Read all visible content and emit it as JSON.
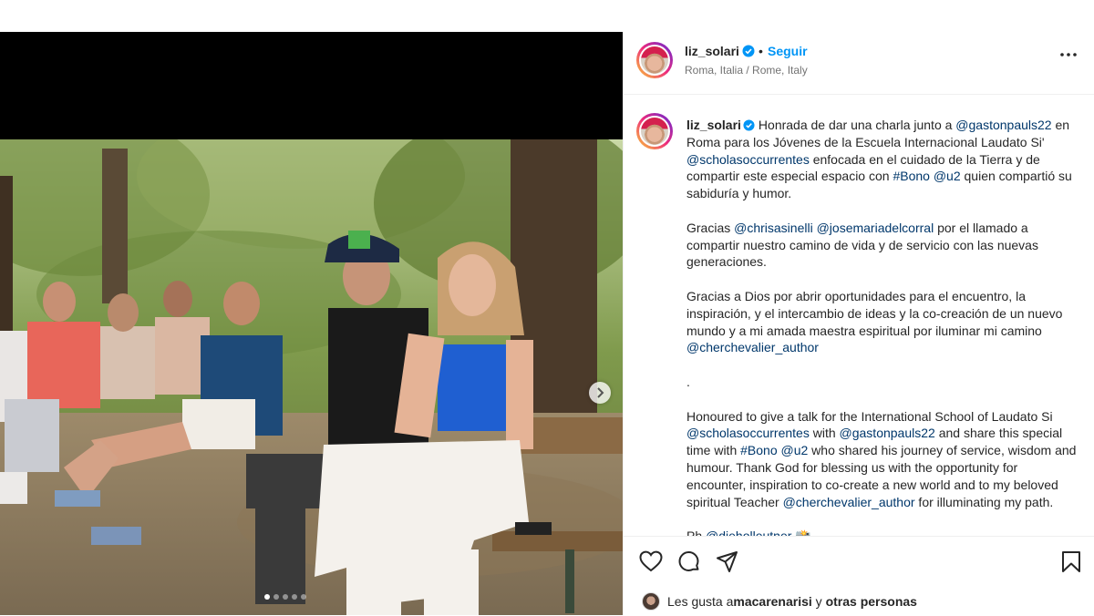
{
  "post": {
    "author": "liz_solari",
    "follow_label": "Seguir",
    "separator": "•",
    "location": "Roma, Italia / Rome, Italy"
  },
  "caption": {
    "p1": [
      {
        "t": "Honrada de dar una charla junto a ",
        "link": false
      },
      {
        "t": "@gastonpauls22",
        "link": true
      },
      {
        "t": " en Roma para los Jóvenes de la Escuela Internacional Laudato Si' ",
        "link": false
      },
      {
        "t": "@scholasoccurrentes",
        "link": true
      },
      {
        "t": " enfocada en el cuidado de la Tierra y de compartir este especial espacio con ",
        "link": false
      },
      {
        "t": "#Bono",
        "link": true
      },
      {
        "t": " ",
        "link": false
      },
      {
        "t": "@u2",
        "link": true
      },
      {
        "t": " quien compartió su sabiduría y humor.",
        "link": false
      }
    ],
    "p2": [
      {
        "t": "Gracias ",
        "link": false
      },
      {
        "t": "@chrisasinelli",
        "link": true
      },
      {
        "t": " ",
        "link": false
      },
      {
        "t": "@josemariadelcorral",
        "link": true
      },
      {
        "t": " por el llamado a compartir nuestro camino de vida y de servicio con las nuevas generaciones.",
        "link": false
      }
    ],
    "p3": [
      {
        "t": "Gracias a Dios por abrir oportunidades para el encuentro, la inspiración, y el intercambio de ideas y la co-creación de un nuevo mundo y a mi amada maestra espiritual por iluminar mi camino ",
        "link": false
      },
      {
        "t": "@cherchevalier_author",
        "link": true
      }
    ],
    "p4": [
      {
        "t": ".",
        "link": false
      }
    ],
    "p5": [
      {
        "t": "Honoured to give a talk for the International School of Laudato Si ",
        "link": false
      },
      {
        "t": "@scholasoccurrentes",
        "link": true
      },
      {
        "t": " with ",
        "link": false
      },
      {
        "t": "@gastonpauls22",
        "link": true
      },
      {
        "t": " and share this special time with ",
        "link": false
      },
      {
        "t": "#Bono",
        "link": true
      },
      {
        "t": " ",
        "link": false
      },
      {
        "t": "@u2",
        "link": true
      },
      {
        "t": " who shared his journey of service, wisdom and humour. Thank God for blessing us with the opportunity for encounter, inspiration to co-create a new world and to my beloved spiritual Teacher ",
        "link": false
      },
      {
        "t": "@cherchevalier_author",
        "link": true
      },
      {
        "t": " for illuminating my path.",
        "link": false
      }
    ],
    "p6": [
      {
        "t": "Ph ",
        "link": false
      },
      {
        "t": "@dieholleutner",
        "link": true
      },
      {
        "t": " 📸",
        "link": false
      }
    ]
  },
  "likes": {
    "prefix": "Les gusta a ",
    "user": "macarenarisi",
    "middle": " y ",
    "others": "otras personas"
  },
  "icons": {
    "verified": "verified-badge-icon",
    "more": "more-options-icon",
    "like": "heart-icon",
    "comment": "comment-icon",
    "share": "share-icon",
    "save": "bookmark-icon",
    "next": "chevron-right-icon"
  },
  "colors": {
    "link": "#00376b",
    "follow": "#0095f6",
    "verified": "#0095f6",
    "muted": "#737373"
  },
  "carousel": {
    "slide_count": 5,
    "active_index": 0
  }
}
